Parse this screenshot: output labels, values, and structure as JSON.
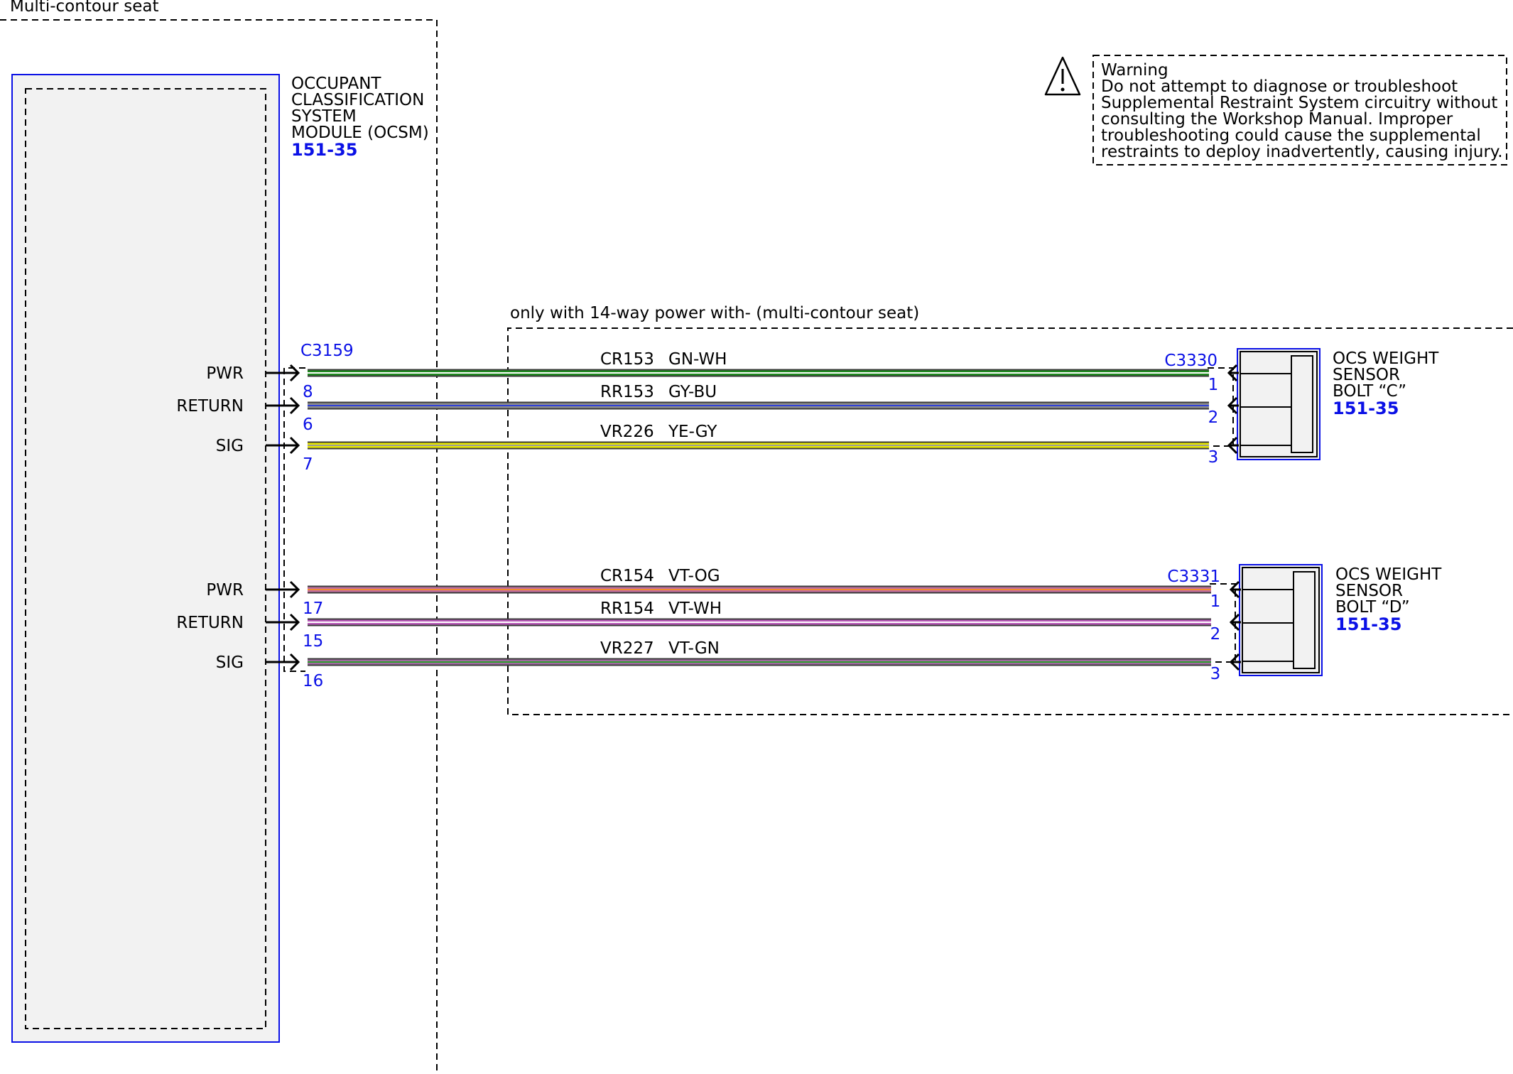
{
  "colors": {
    "connector_blue": "#0a10e6",
    "module_fill": "#f2f2f2"
  },
  "outer_group": {
    "label": "Multi-contour seat"
  },
  "module": {
    "name_lines": [
      "OCCUPANT",
      "CLASSIFICATION",
      "SYSTEM",
      "MODULE (OCSM)"
    ],
    "ref": "151-35",
    "connector": "C3159"
  },
  "warning": {
    "icon": "warning-triangle-icon",
    "title": "Warning",
    "lines": [
      "Do not attempt to diagnose or troubleshoot",
      "Supplemental Restraint System circuitry without",
      "consulting the Workshop Manual. Improper",
      "troubleshooting could cause the supplemental",
      "restraints to deploy inadvertently, causing injury."
    ]
  },
  "option_group": {
    "label": "only with 14-way power with- (multi-contour seat)"
  },
  "sensors": [
    {
      "name_lines": [
        "OCS WEIGHT",
        "SENSOR",
        "BOLT “C”"
      ],
      "ref": "151-35",
      "connector": "C3330",
      "circuits": [
        {
          "signal": "PWR",
          "module_pin": "8",
          "circuit": "CR153",
          "color_code": "GN-WH",
          "sensor_pin": "1",
          "wire_main": "#1f8a1f",
          "wire_stripe": "#ffffff"
        },
        {
          "signal": "RETURN",
          "module_pin": "6",
          "circuit": "RR153",
          "color_code": "GY-BU",
          "sensor_pin": "2",
          "wire_main": "#8f8f8f",
          "wire_stripe": "#2f3fd8"
        },
        {
          "signal": "SIG",
          "module_pin": "7",
          "circuit": "VR226",
          "color_code": "YE-GY",
          "sensor_pin": "3",
          "wire_main": "#e8e800",
          "wire_stripe": "#9a9a9a"
        }
      ]
    },
    {
      "name_lines": [
        "OCS WEIGHT",
        "SENSOR",
        "BOLT “D”"
      ],
      "ref": "151-35",
      "connector": "C3331",
      "circuits": [
        {
          "signal": "PWR",
          "module_pin": "17",
          "circuit": "CR154",
          "color_code": "VT-OG",
          "sensor_pin": "1",
          "wire_main": "#c4709e",
          "wire_stripe": "#f08a2e"
        },
        {
          "signal": "RETURN",
          "module_pin": "15",
          "circuit": "RR154",
          "color_code": "VT-WH",
          "sensor_pin": "2",
          "wire_main": "#b85ab8",
          "wire_stripe": "#ffffff"
        },
        {
          "signal": "SIG",
          "module_pin": "16",
          "circuit": "VR227",
          "color_code": "VT-GN",
          "sensor_pin": "3",
          "wire_main": "#a06aa0",
          "wire_stripe": "#2fa02f"
        }
      ]
    }
  ]
}
